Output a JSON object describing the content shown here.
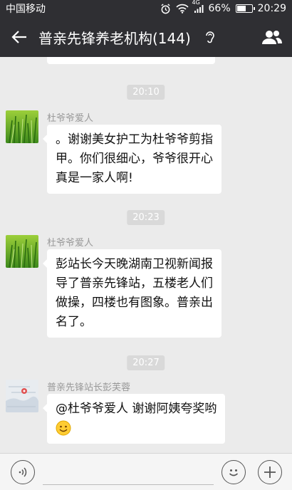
{
  "status_bar": {
    "carrier": "中国移动",
    "network": "4G",
    "battery": "66%",
    "battery_level": 0.66,
    "time": "20:29"
  },
  "header": {
    "title": "普亲先锋养老机构(144)"
  },
  "messages": [
    {
      "time": "20:10",
      "sender": "杜爷爷爱人",
      "lines": [
        "。谢谢美女护工为杜爷爷剪指",
        "甲。你们很细心，爷爷很开心",
        "真是一家人啊!"
      ]
    },
    {
      "time": "20:23",
      "sender": "杜爷爷爱人",
      "lines": [
        "彭站长今天晚湖南卫视新闻报",
        "导了普亲先锋站，五楼老人们",
        "做操，四楼也有图象。普亲出",
        "名了。"
      ]
    },
    {
      "time": "20:27",
      "sender": "普亲先锋站长彭芙蓉",
      "lines": [
        "@杜爷爷爱人 谢谢阿姨夸奖哟"
      ]
    }
  ],
  "input_bar": {
    "placeholder": ""
  },
  "colors": {
    "bar": "#2f2f33",
    "chat_bg": "#ebebeb",
    "bubble": "#ffffff",
    "time_badge": "#d9d9d9"
  }
}
